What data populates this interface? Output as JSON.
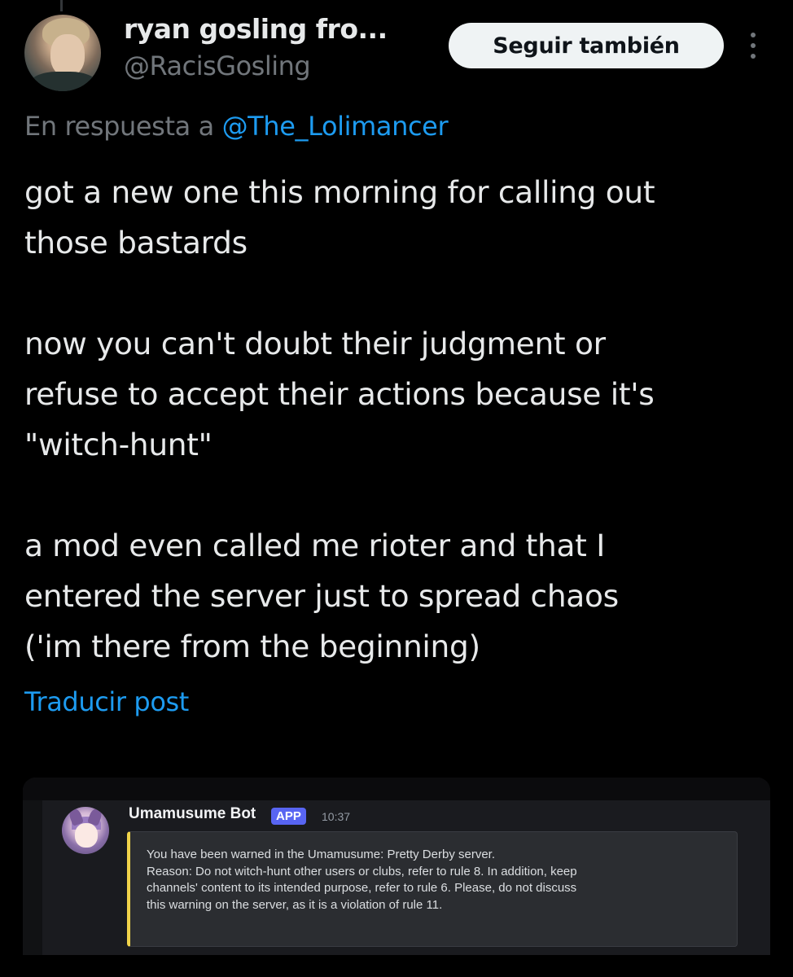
{
  "post": {
    "author": {
      "display_name": "ryan gosling fro...",
      "handle": "@RacisGosling"
    },
    "follow_button_label": "Seguir también",
    "reply_context": {
      "prefix": "En respuesta a",
      "mention": "@The_Lolimancer"
    },
    "body_lines": [
      "got a new one this morning for calling out",
      "those bastards",
      "",
      "now you can't doubt their judgment or",
      "refuse to accept their actions because it's",
      "\"witch-hunt\"",
      "",
      "a mod even called me rioter and that I",
      "entered the server just to spread chaos",
      "('im there from the beginning)"
    ],
    "translate_label": "Traducir post"
  },
  "embed": {
    "bot_name": "Umamusume Bot",
    "badge": "APP",
    "time": "10:37",
    "warning_lines": [
      "You have been warned in the Umamusume: Pretty Derby server.",
      "Reason: Do not witch-hunt other users or clubs, refer to rule 8. In addition, keep",
      "channels' content to its intended purpose, refer to rule 6. Please, do not discuss",
      "this warning on the server, as it is a violation of rule 11."
    ]
  },
  "colors": {
    "background": "#000000",
    "text": "#e7e9ea",
    "muted": "#71767b",
    "link": "#1d9bf0",
    "follow_button": "#eff3f4",
    "discord_badge": "#5865f2",
    "warn_accent": "#f0d34a"
  },
  "icons": {
    "more": "vertical-ellipsis-icon"
  }
}
